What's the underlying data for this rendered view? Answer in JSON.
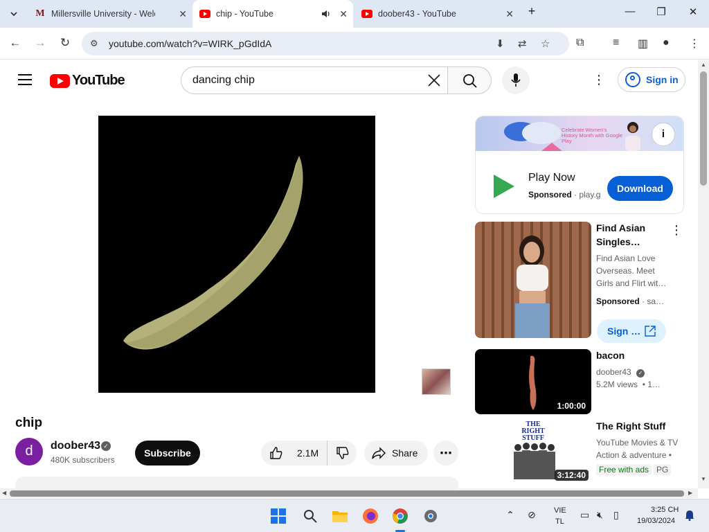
{
  "browser": {
    "tabs": [
      {
        "title": "Millersville University - Welcome",
        "favicon": "millersville-icon",
        "active": false
      },
      {
        "title": "chip - YouTube",
        "favicon": "youtube-icon",
        "active": true,
        "audio": true
      },
      {
        "title": "doober43 - YouTube",
        "favicon": "youtube-icon",
        "active": false
      }
    ],
    "url": "youtube.com/watch?v=WIRK_pGdIdA"
  },
  "youtube": {
    "logo_text": "YouTube",
    "search_query": "dancing chip",
    "sign_in_label": "Sign in",
    "video": {
      "title": "chip",
      "channel": "doober43",
      "channel_initial": "d",
      "subscribers": "480K subscribers",
      "subscribe_label": "Subscribe",
      "likes": "2.1M",
      "share_label": "Share"
    },
    "sidebar": {
      "ad": {
        "banner_text": "Celebrate Women's History Month with Google Play",
        "title": "Play Now",
        "sponsored": "Sponsored",
        "domain": "play.google.com",
        "button": "Download"
      },
      "items": [
        {
          "title": "Find Asian Singles…",
          "line1": "Find Asian Love Overseas. Meet Girls and Flirt wit…",
          "sponsored": "Sponsored",
          "domain": "sa…",
          "button": "Sign …"
        },
        {
          "title": "bacon",
          "channel": "doober43",
          "views": "5.2M views",
          "age": "1…",
          "duration": "1:00:00"
        },
        {
          "title": "The Right Stuff",
          "channel": "YouTube Movies & TV",
          "genre": "Action & adventure •",
          "free": "Free with ads",
          "rating": "PG",
          "duration": "3:12:40",
          "poster_text": "THE RIGHT STUFF"
        }
      ]
    }
  },
  "taskbar": {
    "language": "VIE",
    "language_sub": "TL",
    "time": "3:25 CH",
    "date": "19/03/2024"
  }
}
